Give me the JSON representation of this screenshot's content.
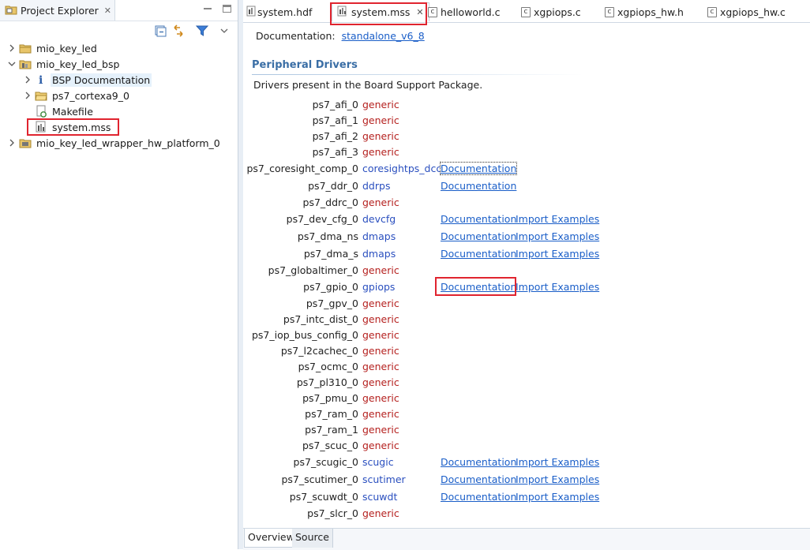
{
  "explorer": {
    "tab_label": "Project Explorer",
    "close_glyph": "✕",
    "toolbar_icons": [
      "collapse-all-icon",
      "link-with-editor-icon",
      "filter-icon",
      "view-menu-icon"
    ],
    "tree": [
      {
        "label": "mio_key_led",
        "level": 0,
        "expanded": false,
        "icon": "project-folder-icon"
      },
      {
        "label": "mio_key_led_bsp",
        "level": 0,
        "expanded": true,
        "icon": "bsp-project-icon"
      },
      {
        "label": "BSP Documentation",
        "level": 1,
        "expanded": false,
        "icon": "info-icon",
        "highlight": true
      },
      {
        "label": "ps7_cortexa9_0",
        "level": 1,
        "expanded": false,
        "icon": "folder-icon"
      },
      {
        "label": "Makefile",
        "level": 1,
        "icon": "makefile-icon"
      },
      {
        "label": "system.mss",
        "level": 1,
        "icon": "mss-file-icon",
        "boxed": true
      },
      {
        "label": "mio_key_led_wrapper_hw_platform_0",
        "level": 0,
        "expanded": false,
        "icon": "hw-platform-icon"
      }
    ]
  },
  "editor": {
    "tabs": [
      {
        "label": "system.hdf",
        "icon": "hdf-file-icon"
      },
      {
        "label": "system.mss",
        "icon": "mss-file-icon",
        "active": true
      },
      {
        "label": "helloworld.c",
        "icon": "c-file-icon"
      },
      {
        "label": "xgpiops.c",
        "icon": "c-file-icon"
      },
      {
        "label": "xgpiops_hw.h",
        "icon": "c-file-icon"
      },
      {
        "label": "xgpiops_hw.c",
        "icon": "c-file-icon"
      }
    ],
    "active_tab_close": "✕",
    "doc_label": "Documentation:",
    "doc_link": "standalone_v6_8",
    "section_title": "Peripheral Drivers",
    "section_desc": "Drivers present in the Board Support Package.",
    "drivers": [
      {
        "name": "ps7_afi_0",
        "driver": "generic"
      },
      {
        "name": "ps7_afi_1",
        "driver": "generic"
      },
      {
        "name": "ps7_afi_2",
        "driver": "generic"
      },
      {
        "name": "ps7_afi_3",
        "driver": "generic"
      },
      {
        "name": "ps7_coresight_comp_0",
        "driver": "coresightps_dcc",
        "doc": "Documentation",
        "focused": true
      },
      {
        "name": "ps7_ddr_0",
        "driver": "ddrps",
        "doc": "Documentation"
      },
      {
        "name": "ps7_ddrc_0",
        "driver": "generic"
      },
      {
        "name": "ps7_dev_cfg_0",
        "driver": "devcfg",
        "doc": "Documentation",
        "examples": "Import Examples"
      },
      {
        "name": "ps7_dma_ns",
        "driver": "dmaps",
        "doc": "Documentation",
        "examples": "Import Examples"
      },
      {
        "name": "ps7_dma_s",
        "driver": "dmaps",
        "doc": "Documentation",
        "examples": "Import Examples"
      },
      {
        "name": "ps7_globaltimer_0",
        "driver": "generic"
      },
      {
        "name": "ps7_gpio_0",
        "driver": "gpiops",
        "doc": "Documentation",
        "examples": "Import Examples",
        "boxed": true
      },
      {
        "name": "ps7_gpv_0",
        "driver": "generic"
      },
      {
        "name": "ps7_intc_dist_0",
        "driver": "generic"
      },
      {
        "name": "ps7_iop_bus_config_0",
        "driver": "generic"
      },
      {
        "name": "ps7_l2cachec_0",
        "driver": "generic"
      },
      {
        "name": "ps7_ocmc_0",
        "driver": "generic"
      },
      {
        "name": "ps7_pl310_0",
        "driver": "generic"
      },
      {
        "name": "ps7_pmu_0",
        "driver": "generic"
      },
      {
        "name": "ps7_ram_0",
        "driver": "generic"
      },
      {
        "name": "ps7_ram_1",
        "driver": "generic"
      },
      {
        "name": "ps7_scuc_0",
        "driver": "generic"
      },
      {
        "name": "ps7_scugic_0",
        "driver": "scugic",
        "doc": "Documentation",
        "examples": "Import Examples"
      },
      {
        "name": "ps7_scutimer_0",
        "driver": "scutimer",
        "doc": "Documentation",
        "examples": "Import Examples"
      },
      {
        "name": "ps7_scuwdt_0",
        "driver": "scuwdt",
        "doc": "Documentation",
        "examples": "Import Examples"
      },
      {
        "name": "ps7_slcr_0",
        "driver": "generic"
      }
    ],
    "bottom_tabs": [
      {
        "label": "Overview",
        "active": true
      },
      {
        "label": "Source"
      }
    ]
  },
  "colors": {
    "highlight_box": "#e0242f",
    "link": "#1a5ec8",
    "generic_driver": "#b5211f",
    "specific_driver": "#2a4fbf",
    "section_title": "#3a6ea5"
  }
}
